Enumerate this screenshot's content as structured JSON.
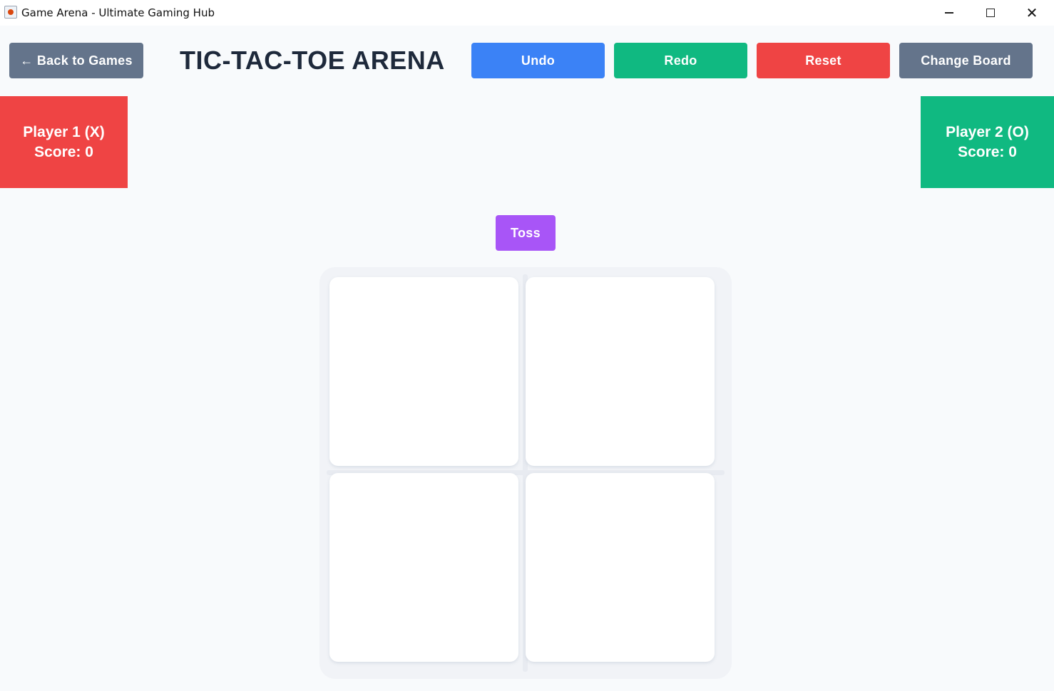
{
  "window": {
    "title": "Game Arena - Ultimate Gaming Hub",
    "controls": {
      "minimize_icon": "minimize-icon",
      "maximize_icon": "maximize-icon",
      "close_icon": "close-icon",
      "close_glyph": "✕"
    }
  },
  "header": {
    "back_label": "← Back to Games",
    "title": "TIC-TAC-TOE ARENA",
    "undo_label": "Undo",
    "redo_label": "Redo",
    "reset_label": "Reset",
    "change_board_label": "Change Board"
  },
  "players": [
    {
      "name": "Player 1 (X)",
      "score": "Score: 0",
      "color": "#ef4444"
    },
    {
      "name": "Player 2 (O)",
      "score": "Score: 0",
      "color": "#10b981"
    }
  ],
  "toss_label": "Toss",
  "board": {
    "rows": 2,
    "cols": 2,
    "cells": [
      "",
      "",
      "",
      ""
    ]
  },
  "colors": {
    "undo": "#3b82f6",
    "redo": "#10b981",
    "reset": "#ef4444",
    "neutral": "#64748b",
    "toss": "#a855f7",
    "background": "#f8fafc"
  }
}
